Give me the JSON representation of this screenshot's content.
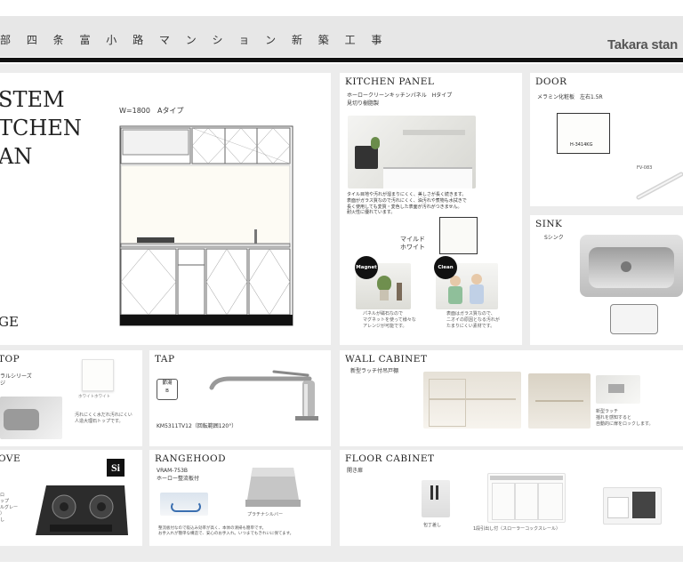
{
  "header": {
    "title": "部 四 条 富 小 路 マ ン シ ョ ン 新 築 工 事",
    "brand": "Takara stan"
  },
  "system": {
    "title_lines": [
      "STEM",
      "TCHEN",
      "AN"
    ],
    "type_label": "W=1800　Aタイプ",
    "footer_label": "GE"
  },
  "kitchen_panel": {
    "title": "KITCHEN PANEL",
    "subtitle": "ホーロークリーンキッチンパネル　Hタイプ",
    "subtitle2": "見切り樹脂製",
    "desc": [
      "タイル目地や汚れが溜まりにくく、美しさが長く続きます。",
      "表面がガラス質なので汚れにくく、油汚れや煮物も水拭きで",
      "長く使用しても変質・変色した表面が汚れがつきません。",
      "耐火性に優れています。"
    ],
    "color_name": [
      "マイルド",
      "ホワイト"
    ],
    "magnet_badge": "Magnet",
    "clean_badge": "Clean",
    "magnet_caption": [
      "パネルが磁石なので",
      "マグネットを使って様々な",
      "アレンジが可能です。"
    ],
    "clean_caption": [
      "表面はガラス質なので、",
      "ニオイの原因となる汚れが",
      "たまりにくい素材です。"
    ]
  },
  "door": {
    "title": "DOOR",
    "subtitle": "メラミン化粧板　左右1.5R",
    "swatch_code": "H-3414KG",
    "handle_code": "FV-083"
  },
  "sink": {
    "title": "SINK",
    "subtitle": "Sシンク"
  },
  "top": {
    "title": "TOP",
    "spec_lines": [
      "ラルシリーズ",
      "ジ"
    ],
    "swatch_text": [
      "ホワイトホワイト"
    ],
    "desc": [
      "汚れにくく水だれ汚れにくい",
      "人造大理石トップです。"
    ]
  },
  "tap": {
    "title": "TAP",
    "badge_lines": [
      "節湯",
      "B"
    ],
    "model": "KM5311TV12（回転範囲120°）"
  },
  "wall_cabinet": {
    "title": "WALL CABINET",
    "subtitle": "新型ラッチ付吊戸棚",
    "caption": [
      "新型ラッチ",
      "揺れを感知すると",
      "自動的に扉をロックします。"
    ]
  },
  "stove": {
    "title": "OVE",
    "si_mark": "Si",
    "spec_lines": [
      "ロ",
      "ップ",
      "ルグレー",
      "）",
      "し"
    ]
  },
  "rangehood": {
    "title": "RANGEHOOD",
    "model": "VRAM-753B",
    "subtitle": "ホーロー整流板付",
    "caption": "プラチナシルバー",
    "desc": [
      "整流板付なので吸込み効率が高く、本体の清掃も簡単です。",
      "お手入れが簡単な構造で、安心のお手入れ。いつまでもきれいに保てます。"
    ]
  },
  "floor_cabinet": {
    "title": "FLOOR CABINET",
    "subtitle": "開き扉",
    "caption1": "包丁差し",
    "caption2": "1段引出し付（スローラーコックスレール）"
  },
  "colors": {
    "ink": "#222222",
    "board": "#ececec",
    "header": "#e7e7e7"
  }
}
